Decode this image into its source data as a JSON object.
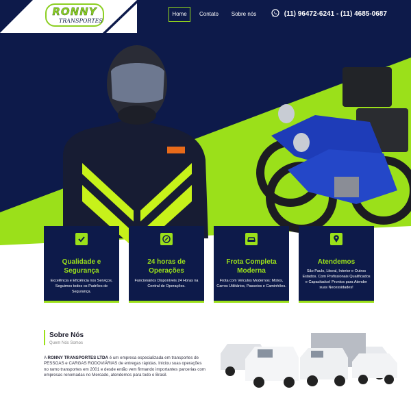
{
  "header": {
    "logo_name": "RONNY",
    "logo_sub": "TRANSPORTES",
    "nav": [
      "Home",
      "Contato",
      "Sobre nós"
    ],
    "phone": "(11) 96472-6241 - (11) 4685-0687",
    "colors": {
      "navy": "#0d1a4a",
      "green": "#9be01a"
    }
  },
  "features": [
    {
      "icon": "check-icon",
      "title": "Qualidade e Segurança",
      "text": "Excelência e Eficiência nos Serviços, Seguimos todos os Padrões de Segurança."
    },
    {
      "icon": "clock-icon",
      "title": "24 horas de Operações",
      "text": "Funcionários Disponíveis 24 Horas na Central de Operações."
    },
    {
      "icon": "car-icon",
      "title": "Frota Completa Moderna",
      "text": "Frota com Veículos Modernos: Motos, Carros Utilitários, Passeios e Caminhões."
    },
    {
      "icon": "location-pin-icon",
      "title": "Atendemos",
      "text": "São Paulo, Litoral, Interior e Outros Estados. Com Profissionais Qualificados e Capacitados! Prontos para Atender suas Necessidades!"
    }
  ],
  "about": {
    "title": "Sobre Nós",
    "subtitle": "Quem Nós Somos",
    "company": "RONNY TRANSPORTES LTDA",
    "text": " é um empresa especializada em transportes de PESSOAS e CARGAS RODOVIÁRIAS de entregas rápidas. Iniciou suas operações no ramo transportes em 2001 e desde então vem firmando importantes parcerias com empresas renomadas no Mercado, atendemos para todo o Brasil.",
    "prefix": "A "
  }
}
